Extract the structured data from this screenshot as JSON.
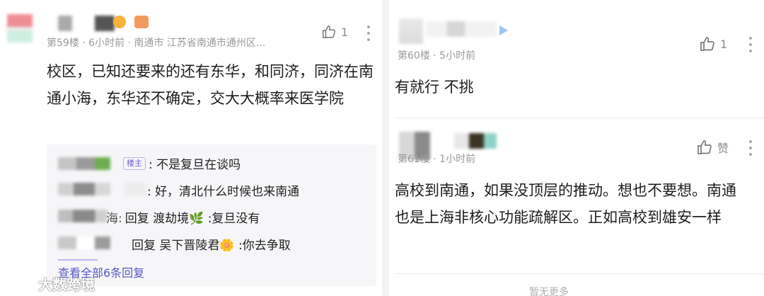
{
  "left_comment": {
    "meta": "第59楼 · 6小时前 · 南通市 江苏省南通市通州区...",
    "like_count": "1",
    "body": "校区，已知还要来的还有东华，和同济，同济在南通小海，东华还不确定，交大大概率来医学院",
    "replies": [
      {
        "badge": "楼主",
        "text": ": 不是复旦在谈吗"
      },
      {
        "text": ": 好，清北什么时候也来南通"
      },
      {
        "prefix": "海:",
        "text": "回复 渡劫境🌿 :复旦没有"
      },
      {
        "text": "回复 吴下晋陵君🌼 :你去争取"
      }
    ],
    "view_all": "查看全部6条回复"
  },
  "right_top_comment": {
    "meta": "第60楼 · 5小时前",
    "like_count": "1",
    "body": "有就行 不挑"
  },
  "right_bottom_comment": {
    "meta": "第61楼 · 1小时前",
    "like_label": "赞",
    "body": "高校到南通，如果没顶层的推动。想也不要想。南通也是上海非核心功能疏解区。正如高校到雄安一样"
  },
  "footer": {
    "no_more": "暂无更多"
  },
  "watermark": {
    "text": "大数跨境"
  },
  "colors": {
    "accent": "#5a58c8",
    "muted": "#9a9a9a",
    "badge": "#6d5fcf"
  }
}
